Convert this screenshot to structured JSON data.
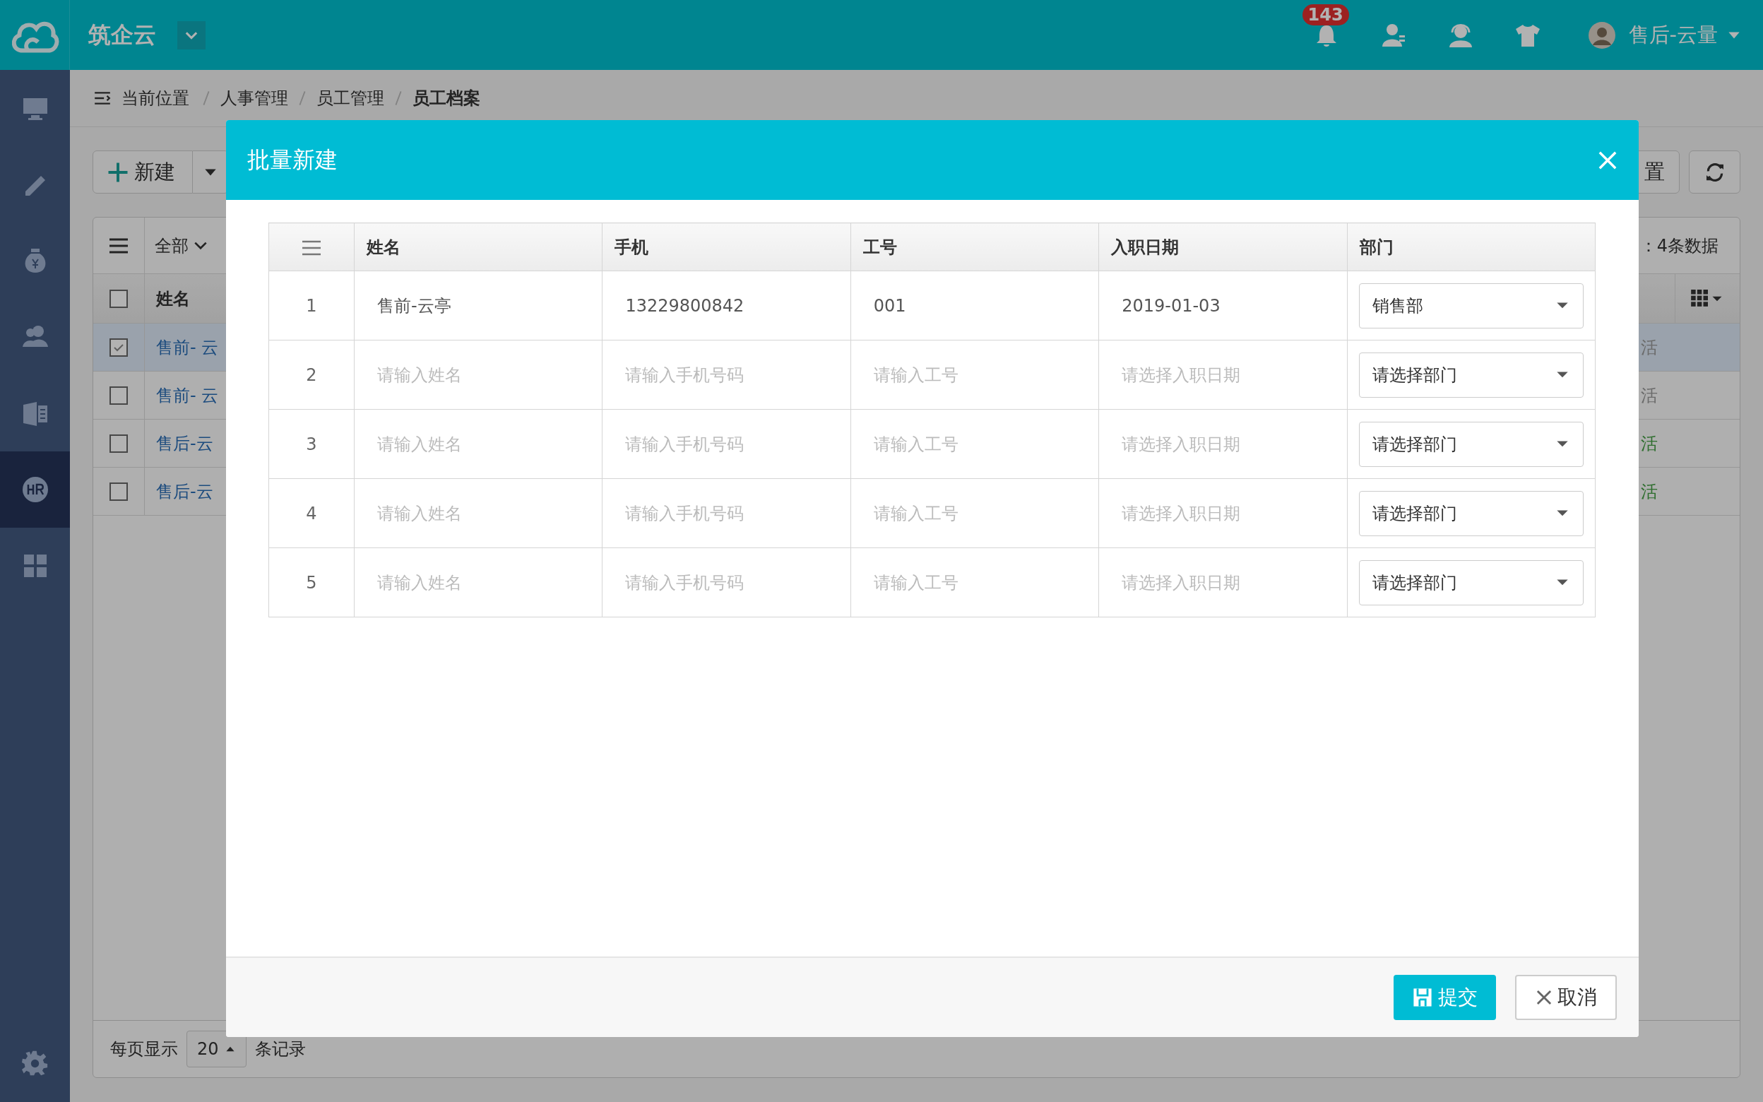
{
  "app": {
    "title": "筑企云",
    "badge": "143",
    "user": "售后-云量"
  },
  "sidebar": {
    "items": [
      {
        "kind": "monitor",
        "selected": false
      },
      {
        "kind": "pencil",
        "selected": false
      },
      {
        "kind": "moneybag",
        "selected": false
      },
      {
        "kind": "people",
        "selected": false
      },
      {
        "kind": "oa",
        "selected": false
      },
      {
        "kind": "hr",
        "selected": true
      },
      {
        "kind": "grid",
        "selected": false
      }
    ]
  },
  "breadcrumb": {
    "label": "当前位置",
    "items": [
      {
        "text": "人事管理",
        "current": false
      },
      {
        "text": "员工管理",
        "current": false
      },
      {
        "text": "员工档案",
        "current": true
      }
    ]
  },
  "toolbar": {
    "new_button": "新建",
    "settings_button": "置"
  },
  "list": {
    "filter": "全部",
    "summary": "：4条数据",
    "header": "姓名",
    "select_all": {
      "checked": false
    },
    "rows": [
      {
        "name": "售前- 云",
        "checked": true,
        "status": "活",
        "color": "#6b6b6b"
      },
      {
        "name": "售前- 云",
        "checked": false,
        "status": "活",
        "color": "#6b6b6b"
      },
      {
        "name": "售后-云",
        "checked": false,
        "status": "活",
        "color": "#2f6e2f"
      },
      {
        "name": "售后-云",
        "checked": false,
        "status": "活",
        "color": "#2f6e2f"
      }
    ]
  },
  "pagination": {
    "label": "每页显示",
    "page_size": "20",
    "suffix": "条记录"
  },
  "dialog": {
    "title": "批量新建",
    "columns": [
      "姓名",
      "手机",
      "工号",
      "入职日期",
      "部门"
    ],
    "rows": [
      {
        "index": "1",
        "fields": [
          {
            "value": "售前-云亭"
          },
          {
            "value": "13229800842"
          },
          {
            "value": "001"
          },
          {
            "value": "2019-01-03"
          }
        ],
        "department": "销售部"
      },
      {
        "index": "2",
        "fields": [
          {
            "placeholder": "请输入姓名"
          },
          {
            "placeholder": "请输入手机号码"
          },
          {
            "placeholder": "请输入工号"
          },
          {
            "placeholder": "请选择入职日期"
          }
        ],
        "department": "请选择部门"
      },
      {
        "index": "3",
        "fields": [
          {
            "placeholder": "请输入姓名"
          },
          {
            "placeholder": "请输入手机号码"
          },
          {
            "placeholder": "请输入工号"
          },
          {
            "placeholder": "请选择入职日期"
          }
        ],
        "department": "请选择部门"
      },
      {
        "index": "4",
        "fields": [
          {
            "placeholder": "请输入姓名"
          },
          {
            "placeholder": "请输入手机号码"
          },
          {
            "placeholder": "请输入工号"
          },
          {
            "placeholder": "请选择入职日期"
          }
        ],
        "department": "请选择部门"
      },
      {
        "index": "5",
        "fields": [
          {
            "placeholder": "请输入姓名"
          },
          {
            "placeholder": "请输入手机号码"
          },
          {
            "placeholder": "请输入工号"
          },
          {
            "placeholder": "请选择入职日期"
          }
        ],
        "department": "请选择部门"
      }
    ],
    "submit": "提交",
    "cancel": "取消"
  }
}
